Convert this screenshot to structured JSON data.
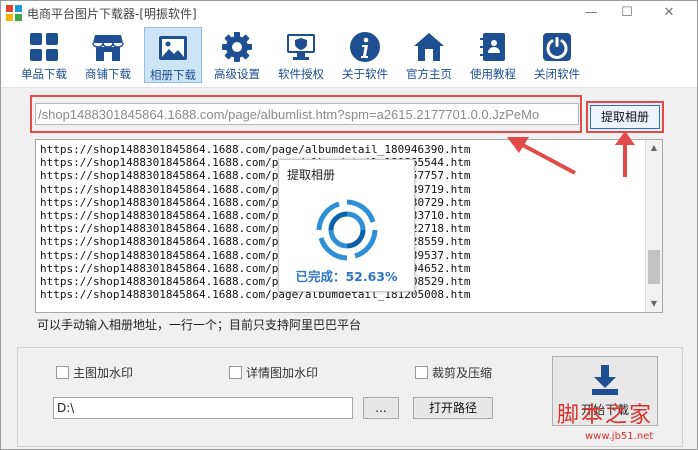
{
  "window": {
    "title": "电商平台图片下载器-[明振软件]",
    "min_icon": "minimize-icon",
    "max_icon": "maximize-icon",
    "close_icon": "close-icon"
  },
  "toolbar": {
    "items": [
      {
        "label": "单品下载",
        "icon": "grid-icon"
      },
      {
        "label": "商铺下载",
        "icon": "store-icon"
      },
      {
        "label": "相册下载",
        "icon": "image-icon",
        "active": true
      },
      {
        "label": "高级设置",
        "icon": "gear-icon"
      },
      {
        "label": "软件授权",
        "icon": "shield-monitor-icon"
      },
      {
        "label": "关于软件",
        "icon": "info-icon"
      },
      {
        "label": "官方主页",
        "icon": "home-icon"
      },
      {
        "label": "使用教程",
        "icon": "book-icon"
      },
      {
        "label": "关闭软件",
        "icon": "power-icon"
      }
    ]
  },
  "url_input": {
    "value": "/shop1488301845864.1688.com/page/albumlist.htm?spm=a2615.2177701.0.0.JzPeMo"
  },
  "fetch_button": {
    "label": "提取相册"
  },
  "album_list": [
    "https://shop1488301845864.1688.com/page/albumdetail_180946390.htm",
    "https://shop1488301845864.1688.com/page/albumdetail_180865544.htm",
    "https://shop1488301845864.1688.com/page/albumdetail_181257757.htm",
    "https://shop1488301845864.1688.com/page/albumdetail_180739719.htm",
    "https://shop1488301845864.1688.com/page/albumdetail_180730729.htm",
    "https://shop1488301845864.1688.com/page/albumdetail_180733710.htm",
    "https://shop1488301845864.1688.com/page/albumdetail_181322718.htm",
    "https://shop1488301845864.1688.com/page/albumdetail_181328559.htm",
    "https://shop1488301845864.1688.com/page/albumdetail_180739537.htm",
    "https://shop1488301845864.1688.com/page/albumdetail_181194652.htm",
    "https://shop1488301845864.1688.com/page/albumdetail_181208529.htm",
    "https://shop1488301845864.1688.com/page/albumdetail_181205008.htm"
  ],
  "hint": "可以手动输入相册地址，一行一个；目前只支持阿里巴巴平台",
  "options": {
    "main_watermark": {
      "label": "主图加水印",
      "checked": false
    },
    "detail_watermark": {
      "label": "详情图加水印",
      "checked": false
    },
    "crop_compress": {
      "label": "裁剪及压缩",
      "checked": false
    }
  },
  "save_path": {
    "value": "D:\\"
  },
  "browse_button": {
    "label": "..."
  },
  "open_path_button": {
    "label": "打开路径"
  },
  "download_button": {
    "label": "开始下载",
    "icon": "download-icon"
  },
  "progress_popup": {
    "title": "提取相册",
    "status": "已完成：52.63%",
    "progress": 0.5263
  },
  "watermark": {
    "text": "脚本之家",
    "url": "www.jb51.net"
  },
  "colors": {
    "accent": "#2d76c8",
    "toolbar_icon": "#1d4f91",
    "annotation": "#e34b4b"
  }
}
